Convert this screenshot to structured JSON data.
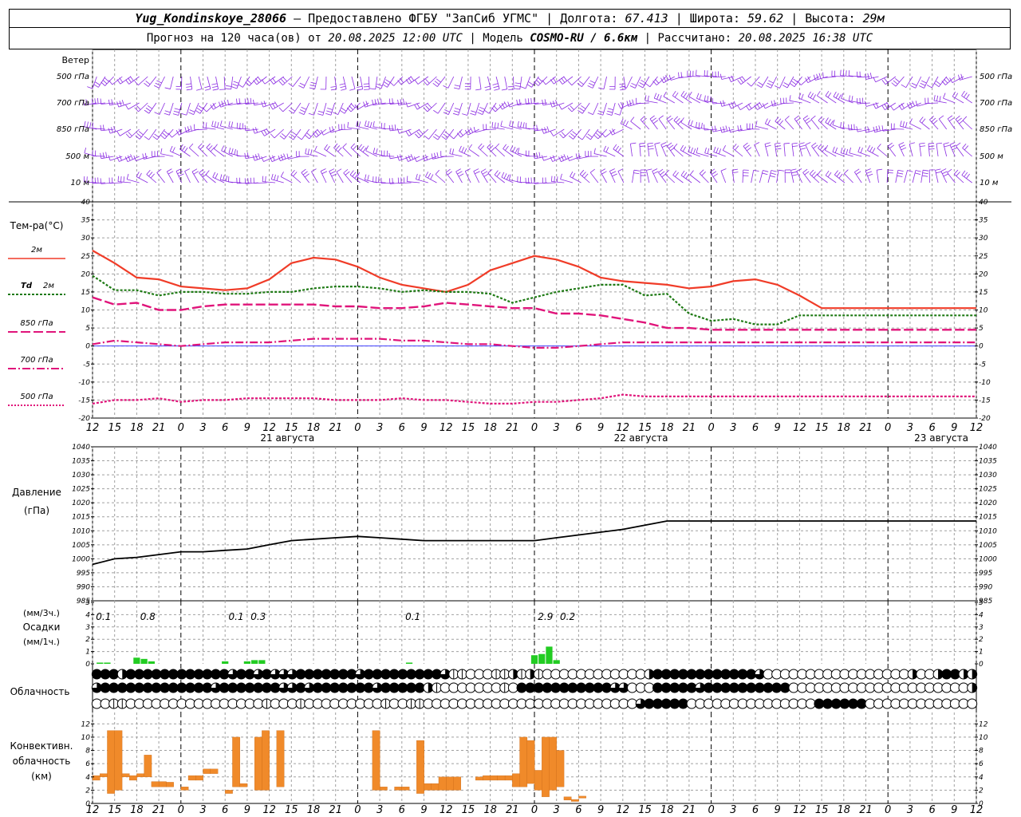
{
  "header": {
    "station": "Yug_Kondinskoye_28066",
    "provider": "– Предоставлено ФГБУ \"ЗапСиб УГМС\" |",
    "lon_label": "Долгота:",
    "lon": "67.413",
    "lat_label": "| Широта:",
    "lat": "59.62",
    "alt_label": "| Высота:",
    "alt": "29м",
    "forecast_label": "Прогноз на 120 часа(ов) от",
    "forecast_start": "20.08.2025 12:00 UTC",
    "model_label": " | Модель",
    "model": "COSMO-RU / 6.6км",
    "computed_label": "| Рассчитано:",
    "computed": "20.08.2025 16:38 UTC"
  },
  "labels": {
    "wind": "Ветер",
    "levels": [
      "500 гПа",
      "700 гПа",
      "850 гПа",
      "500 м",
      "10  м"
    ],
    "temp": "Тем-ра(°C)",
    "t2m": "2м",
    "td": "Td",
    "td2m": "2м",
    "t850": "850 гПа",
    "t700": "700 гПа",
    "t500": "500 гПа",
    "pressure": "Давление",
    "pressure_units": "(гПа)",
    "precip_3h": "(мм/3ч.)",
    "precip": "Осадки",
    "precip_1h": "(мм/1ч.)",
    "cloud": "Облачность",
    "conv1": "Конвективн.",
    "conv2": "облачность",
    "conv3": "(км)"
  },
  "colors": {
    "t2m": "#f03c28",
    "td": "#1e7a14",
    "t850": "#e0147a",
    "t700": "#e0147a",
    "t500": "#e0147a",
    "wind": "#8a2be2",
    "precip": "#22cc22",
    "conv": "#f08a2a",
    "grid": "#a0a0a0",
    "zero": "#4040ff"
  },
  "chart_data": [
    {
      "type": "line",
      "title": "Тем-ра(°C)",
      "x_hours": [
        0,
        3,
        6,
        9,
        12,
        15,
        18,
        21,
        24,
        27,
        30,
        33,
        36,
        39,
        42,
        45,
        48,
        51,
        54,
        57,
        60,
        63,
        66,
        69,
        72,
        75,
        78,
        81,
        84,
        87,
        90,
        93,
        96,
        99,
        102,
        105,
        108,
        111,
        114,
        117,
        120
      ],
      "x_tick_labels": [
        "12",
        "15",
        "18",
        "21",
        "0",
        "3",
        "6",
        "9",
        "12",
        "15",
        "18",
        "21",
        "0",
        "3",
        "6",
        "9",
        "12",
        "15",
        "18",
        "21",
        "0",
        "3",
        "6",
        "9",
        "12",
        "15",
        "18",
        "21",
        "0",
        "3",
        "6",
        "9",
        "12",
        "15",
        "18",
        "21",
        "0",
        "3",
        "6",
        "9",
        "12",
        "15",
        "18"
      ],
      "day_labels": [
        "21 августа",
        "22 августа",
        "23 августа"
      ],
      "ylim": [
        -20,
        40
      ],
      "yticks": [
        -20,
        -15,
        -10,
        -5,
        0,
        5,
        10,
        15,
        20,
        25,
        30,
        35,
        40
      ],
      "series": [
        {
          "name": "2м",
          "style": "solid",
          "values": [
            26.5,
            23,
            19,
            18.5,
            16.5,
            16,
            15.5,
            16,
            18.5,
            23,
            24.5,
            24,
            22,
            19,
            17,
            16,
            15,
            17,
            21,
            23,
            25,
            24,
            22,
            19,
            18,
            17.5,
            17,
            16,
            16.5,
            18,
            18.5,
            17,
            14,
            10.5,
            10.5,
            10.5,
            10.5,
            10.5,
            10.5,
            10.5,
            10.5
          ]
        },
        {
          "name": "Td 2м",
          "style": "dotted",
          "values": [
            19.5,
            15.5,
            15.5,
            14,
            15,
            15,
            14.5,
            14.5,
            15,
            15,
            16,
            16.5,
            16.5,
            16,
            15,
            15.5,
            15,
            15,
            14.5,
            12,
            13.5,
            15,
            16,
            17,
            17,
            14,
            14.5,
            9,
            7,
            7.5,
            6,
            6,
            8.5,
            8.5,
            8.5,
            8.5,
            8.5,
            8.5,
            8.5,
            8.5,
            8.5
          ]
        },
        {
          "name": "850 гПа",
          "style": "dashed",
          "values": [
            13.5,
            11.5,
            12,
            10,
            10,
            11,
            11.5,
            11.5,
            11.5,
            11.5,
            11.5,
            11,
            11,
            10.5,
            10.5,
            11,
            12,
            11.5,
            11,
            10.5,
            10.5,
            9,
            9,
            8.5,
            7.5,
            6.5,
            5,
            5,
            4.5,
            4.5,
            4.5,
            4.5,
            4.5,
            4.5,
            4.5,
            4.5,
            4.5,
            4.5,
            4.5,
            4.5,
            4.5
          ]
        },
        {
          "name": "700 гПа",
          "style": "dashdot",
          "values": [
            0.5,
            1.5,
            1,
            0.5,
            0,
            0.5,
            1,
            1,
            1,
            1.5,
            2,
            2,
            2,
            2,
            1.5,
            1.5,
            1,
            0.5,
            0.5,
            0,
            -0.5,
            -0.5,
            0,
            0.5,
            1,
            1,
            1,
            1,
            1,
            1,
            1,
            1,
            1,
            1,
            1,
            1,
            1,
            1,
            1,
            1,
            1
          ]
        },
        {
          "name": "500 гПа",
          "style": "dotted",
          "values": [
            -16,
            -15,
            -15,
            -14.5,
            -15.5,
            -15,
            -15,
            -14.5,
            -14.5,
            -14.5,
            -14.5,
            -15,
            -15,
            -15,
            -14.5,
            -15,
            -15,
            -15.5,
            -16,
            -16,
            -15.5,
            -15.5,
            -15,
            -14.5,
            -13.5,
            -14,
            -14,
            -14,
            -14,
            -14,
            -14,
            -14,
            -14,
            -14,
            -14,
            -14,
            -14,
            -14,
            -14,
            -14,
            -14
          ]
        }
      ]
    },
    {
      "type": "line",
      "title": "Давление (гПа)",
      "ylim": [
        985,
        1040
      ],
      "yticks": [
        985,
        990,
        995,
        1000,
        1005,
        1010,
        1015,
        1020,
        1025,
        1030,
        1035,
        1040
      ],
      "series": [
        {
          "name": "Давление",
          "values": [
            998,
            1000,
            1000.5,
            1001.5,
            1002.5,
            1002.5,
            1003,
            1003.5,
            1005,
            1006.5,
            1007,
            1007.5,
            1008,
            1007.5,
            1007,
            1006.5,
            1006.5,
            1006.5,
            1006.5,
            1006.5,
            1006.5,
            1007.5,
            1008.5,
            1009.5,
            1010.5,
            1012,
            1013.5,
            1013.5,
            1013.5,
            1013.5,
            1013.5,
            1013.5,
            1013.5,
            1013.5,
            1013.5,
            1013.5,
            1013.5,
            1013.5,
            1013.5,
            1013.5,
            1013.5
          ]
        }
      ]
    },
    {
      "type": "bar",
      "title": "Осадки",
      "ylim": [
        0,
        5
      ],
      "yticks": [
        0,
        1,
        2,
        3,
        4,
        5
      ],
      "sums_3h": [
        {
          "hour": 1.5,
          "label": "0.1"
        },
        {
          "hour": 7.5,
          "label": "0.8"
        },
        {
          "hour": 19.5,
          "label": "0.1"
        },
        {
          "hour": 22.5,
          "label": "0.3"
        },
        {
          "hour": 43.5,
          "label": "0.1"
        },
        {
          "hour": 61.5,
          "label": "2.9"
        },
        {
          "hour": 64.5,
          "label": "0.2"
        }
      ],
      "hourly": [
        {
          "hour": 1,
          "value": 0.1
        },
        {
          "hour": 2,
          "value": 0.1
        },
        {
          "hour": 6,
          "value": 0.5
        },
        {
          "hour": 7,
          "value": 0.4
        },
        {
          "hour": 8,
          "value": 0.2
        },
        {
          "hour": 18,
          "value": 0.2
        },
        {
          "hour": 21,
          "value": 0.2
        },
        {
          "hour": 22,
          "value": 0.3
        },
        {
          "hour": 23,
          "value": 0.3
        },
        {
          "hour": 43,
          "value": 0.1
        },
        {
          "hour": 60,
          "value": 0.7
        },
        {
          "hour": 61,
          "value": 0.8
        },
        {
          "hour": 62,
          "value": 1.4
        },
        {
          "hour": 63,
          "value": 0.3
        }
      ]
    },
    {
      "type": "bar",
      "title": "Конвективн. облачность (км)",
      "ylim": [
        0,
        13
      ],
      "yticks": [
        0,
        2,
        4,
        6,
        8,
        10,
        12
      ],
      "layers": [
        {
          "hour": 0,
          "base": 3.5,
          "top": 4.2
        },
        {
          "hour": 1,
          "base": 4,
          "top": 4.5
        },
        {
          "hour": 2,
          "base": 1.5,
          "top": 11
        },
        {
          "hour": 3,
          "base": 2,
          "top": 11
        },
        {
          "hour": 4,
          "base": 4,
          "top": 4.5
        },
        {
          "hour": 5,
          "base": 3.5,
          "top": 4.2
        },
        {
          "hour": 6,
          "base": 4,
          "top": 4.5
        },
        {
          "hour": 7,
          "base": 4,
          "top": 7.3
        },
        {
          "hour": 8,
          "base": 2.5,
          "top": 3.3
        },
        {
          "hour": 9,
          "base": 2.5,
          "top": 3.3
        },
        {
          "hour": 10,
          "base": 2.5,
          "top": 3.2
        },
        {
          "hour": 12,
          "base": 2,
          "top": 2.5
        },
        {
          "hour": 13,
          "base": 3.5,
          "top": 4.2
        },
        {
          "hour": 14,
          "base": 3.5,
          "top": 4.2
        },
        {
          "hour": 15,
          "base": 4.5,
          "top": 5.2
        },
        {
          "hour": 16,
          "base": 4.5,
          "top": 5.2
        },
        {
          "hour": 18,
          "base": 1.5,
          "top": 2
        },
        {
          "hour": 19,
          "base": 2.5,
          "top": 10
        },
        {
          "hour": 20,
          "base": 2.5,
          "top": 3
        },
        {
          "hour": 22,
          "base": 2,
          "top": 10
        },
        {
          "hour": 23,
          "base": 2,
          "top": 11
        },
        {
          "hour": 25,
          "base": 2.5,
          "top": 11
        },
        {
          "hour": 38,
          "base": 2,
          "top": 11
        },
        {
          "hour": 39,
          "base": 2,
          "top": 2.5
        },
        {
          "hour": 41,
          "base": 2,
          "top": 2.5
        },
        {
          "hour": 42,
          "base": 2,
          "top": 2.5
        },
        {
          "hour": 44,
          "base": 1.5,
          "top": 9.5
        },
        {
          "hour": 45,
          "base": 2,
          "top": 3
        },
        {
          "hour": 46,
          "base": 2,
          "top": 3
        },
        {
          "hour": 47,
          "base": 2,
          "top": 4
        },
        {
          "hour": 48,
          "base": 2,
          "top": 4
        },
        {
          "hour": 49,
          "base": 2,
          "top": 4
        },
        {
          "hour": 52,
          "base": 3.5,
          "top": 4
        },
        {
          "hour": 53,
          "base": 3.5,
          "top": 4.2
        },
        {
          "hour": 54,
          "base": 3.5,
          "top": 4.2
        },
        {
          "hour": 55,
          "base": 3.5,
          "top": 4.2
        },
        {
          "hour": 56,
          "base": 3.5,
          "top": 4.2
        },
        {
          "hour": 57,
          "base": 2.5,
          "top": 4.5
        },
        {
          "hour": 58,
          "base": 2.5,
          "top": 10
        },
        {
          "hour": 59,
          "base": 3,
          "top": 9.5
        },
        {
          "hour": 60,
          "base": 2,
          "top": 5
        },
        {
          "hour": 61,
          "base": 1,
          "top": 10
        },
        {
          "hour": 62,
          "base": 2,
          "top": 10
        },
        {
          "hour": 63,
          "base": 2.5,
          "top": 8
        },
        {
          "hour": 64,
          "base": 0.5,
          "top": 1
        },
        {
          "hour": 65,
          "base": 0.3,
          "top": 0.6
        },
        {
          "hour": 66,
          "base": 0.8,
          "top": 1.1
        }
      ]
    },
    {
      "type": "table",
      "title": "Облачность",
      "legend_note": "cloud cover symbols, eighths (0=clear circle, 8=filled circle), three layers",
      "rows": [
        [
          8,
          8,
          8,
          4,
          8,
          8,
          8,
          8,
          8,
          8,
          8,
          8,
          8,
          8,
          8,
          8,
          5,
          8,
          8,
          5,
          8,
          5,
          6,
          6,
          8,
          8,
          8,
          8,
          8,
          8,
          8,
          5,
          8,
          8,
          8,
          8,
          8,
          8,
          8,
          8,
          8,
          5,
          2,
          2,
          0,
          0,
          0,
          1,
          2,
          3,
          2,
          4,
          2,
          0,
          0,
          0,
          0,
          0,
          0,
          0,
          0,
          0,
          0,
          0,
          0,
          4,
          8,
          8,
          8,
          8,
          8,
          8,
          8,
          8,
          8,
          8,
          8,
          8,
          5,
          0,
          0,
          0,
          0,
          0,
          0,
          0,
          0,
          0,
          0,
          0,
          0,
          0,
          0,
          0,
          0,
          0,
          4,
          0,
          0,
          4,
          8,
          8,
          4,
          4
        ],
        [
          5,
          8,
          8,
          8,
          8,
          8,
          8,
          8,
          8,
          8,
          8,
          8,
          8,
          8,
          5,
          8,
          8,
          8,
          8,
          8,
          8,
          8,
          6,
          5,
          8,
          6,
          8,
          8,
          8,
          8,
          8,
          8,
          8,
          5,
          8,
          8,
          8,
          8,
          8,
          4,
          2,
          0,
          0,
          0,
          0,
          0,
          0,
          0,
          2,
          0,
          8,
          8,
          8,
          8,
          8,
          8,
          8,
          8,
          8,
          8,
          8,
          5,
          5,
          0,
          0,
          0,
          8,
          8,
          8,
          8,
          8,
          5,
          8,
          8,
          8,
          8,
          8,
          8,
          8,
          8,
          8,
          8,
          0,
          0,
          0,
          0,
          0,
          0,
          0,
          0,
          0,
          0,
          0,
          0,
          0,
          0,
          0,
          0,
          0,
          0,
          0,
          0,
          0,
          4
        ],
        [
          0,
          0,
          2,
          2,
          0,
          0,
          0,
          0,
          0,
          0,
          0,
          0,
          0,
          0,
          0,
          0,
          0,
          0,
          0,
          0,
          2,
          0,
          0,
          0,
          2,
          0,
          0,
          0,
          0,
          0,
          0,
          0,
          0,
          0,
          2,
          0,
          0,
          2,
          2,
          0,
          0,
          0,
          0,
          0,
          0,
          0,
          0,
          0,
          0,
          0,
          0,
          0,
          0,
          0,
          0,
          0,
          0,
          0,
          0,
          0,
          0,
          0,
          0,
          0,
          5,
          8,
          8,
          8,
          8,
          8,
          0,
          0,
          0,
          0,
          0,
          0,
          0,
          0,
          0,
          0,
          0,
          0,
          0,
          0,
          0,
          8,
          8,
          8,
          8,
          8,
          8,
          0,
          0,
          0,
          0,
          0,
          0,
          0,
          0,
          0,
          0,
          0,
          0,
          0
        ]
      ]
    }
  ]
}
